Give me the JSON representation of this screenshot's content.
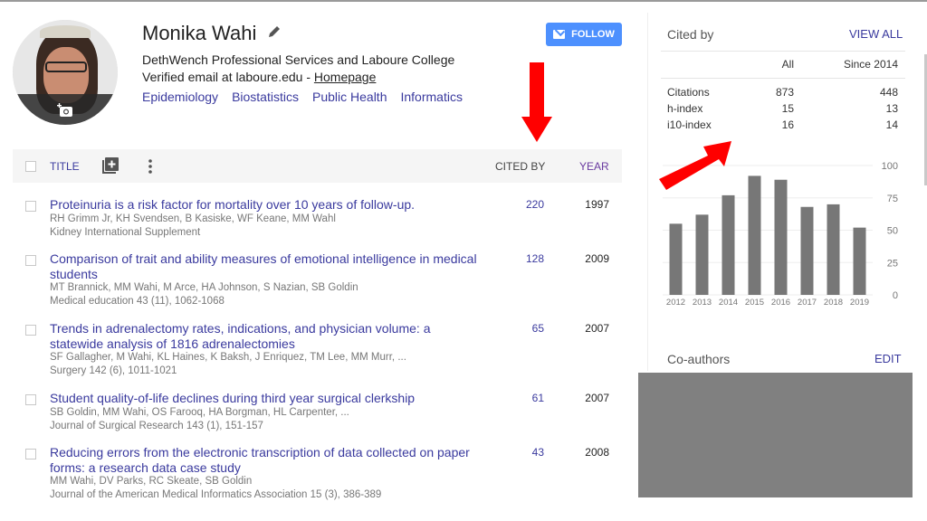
{
  "profile": {
    "name": "Monika Wahi",
    "affiliation": "DethWench Professional Services and Laboure College",
    "email_text": "Verified email at laboure.edu - ",
    "homepage_label": "Homepage",
    "interests": [
      "Epidemiology",
      "Biostatistics",
      "Public Health",
      "Informatics"
    ],
    "follow_label": "FOLLOW"
  },
  "table": {
    "title_header": "TITLE",
    "cited_header": "CITED BY",
    "year_header": "YEAR",
    "rows": [
      {
        "title": "Proteinuria is a risk factor for mortality over 10 years of follow-up.",
        "authors": "RH Grimm Jr, KH Svendsen, B Kasiske, WF Keane, MM Wahl",
        "venue": "Kidney International Supplement",
        "cited": "220",
        "year": "1997"
      },
      {
        "title": "Comparison of trait and ability measures of emotional intelligence in medical students",
        "authors": "MT Brannick, MM Wahi, M Arce, HA Johnson, S Nazian, SB Goldin",
        "venue": "Medical education 43 (11), 1062-1068",
        "cited": "128",
        "year": "2009"
      },
      {
        "title": "Trends in adrenalectomy rates, indications, and physician volume: a statewide analysis of 1816 adrenalectomies",
        "authors": "SF Gallagher, M Wahi, KL Haines, K Baksh, J Enriquez, TM Lee, MM Murr, ...",
        "venue": "Surgery 142 (6), 1011-1021",
        "cited": "65",
        "year": "2007"
      },
      {
        "title": "Student quality-of-life declines during third year surgical clerkship",
        "authors": "SB Goldin, MM Wahi, OS Farooq, HA Borgman, HL Carpenter, ...",
        "venue": "Journal of Surgical Research 143 (1), 151-157",
        "cited": "61",
        "year": "2007"
      },
      {
        "title": "Reducing errors from the electronic transcription of data collected on paper forms: a research data case study",
        "authors": "MM Wahi, DV Parks, RC Skeate, SB Goldin",
        "venue": "Journal of the American Medical Informatics Association 15 (3), 386-389",
        "cited": "43",
        "year": "2008"
      }
    ]
  },
  "cited_by": {
    "heading": "Cited by",
    "view_all": "VIEW ALL",
    "col_all": "All",
    "col_since": "Since 2014",
    "stats": [
      {
        "label": "Citations",
        "all": "873",
        "since": "448"
      },
      {
        "label": "h-index",
        "all": "15",
        "since": "13"
      },
      {
        "label": "i10-index",
        "all": "16",
        "since": "14"
      }
    ]
  },
  "coauthors": {
    "heading": "Co-authors",
    "edit": "EDIT"
  },
  "colors": {
    "link": "#3a3a9e",
    "follow_button": "#4d90fe",
    "bar": "#777777",
    "annotation_arrow": "#ff0000"
  },
  "chart_data": {
    "type": "bar",
    "title": "",
    "xlabel": "",
    "ylabel": "",
    "categories": [
      "2012",
      "2013",
      "2014",
      "2015",
      "2016",
      "2017",
      "2018",
      "2019"
    ],
    "values": [
      55,
      62,
      77,
      92,
      89,
      68,
      70,
      52
    ],
    "ylim": [
      0,
      100
    ],
    "yticks": [
      0,
      25,
      50,
      75,
      100
    ],
    "grid": true,
    "y_axis_side": "right"
  }
}
